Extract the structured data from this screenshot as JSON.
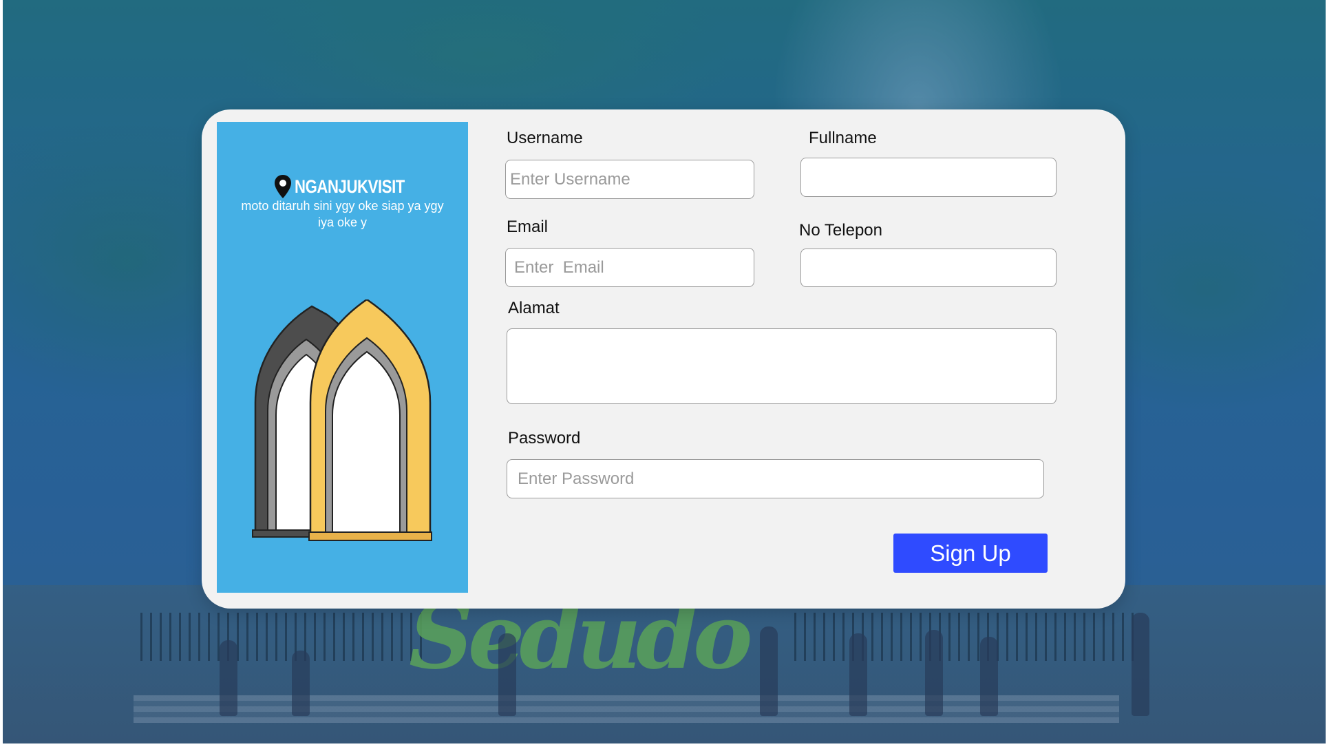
{
  "brand": {
    "name": "NGANJUKVISIT",
    "motto": "moto ditaruh sini ygy oke siap ya ygy iya oke y",
    "pin_icon": "map-pin-icon",
    "illustration": "gate-arches-illustration"
  },
  "background": {
    "sign_text": "Sedudo"
  },
  "form": {
    "username": {
      "label": "Username",
      "placeholder": "Enter Username",
      "value": ""
    },
    "fullname": {
      "label": "Fullname",
      "placeholder": "",
      "value": ""
    },
    "email": {
      "label": "Email",
      "placeholder": "Enter  Email",
      "value": ""
    },
    "phone": {
      "label": "No Telepon",
      "placeholder": "",
      "value": ""
    },
    "address": {
      "label": "Alamat",
      "placeholder": "",
      "value": ""
    },
    "password": {
      "label": "Password",
      "placeholder": "Enter Password",
      "value": ""
    },
    "submit_label": "Sign Up"
  },
  "colors": {
    "side_panel": "#45b0e5",
    "button": "#2f4bff",
    "card": "#f2f2f2",
    "gate_front": "#f7c95c",
    "gate_back": "#4d4d4d"
  }
}
